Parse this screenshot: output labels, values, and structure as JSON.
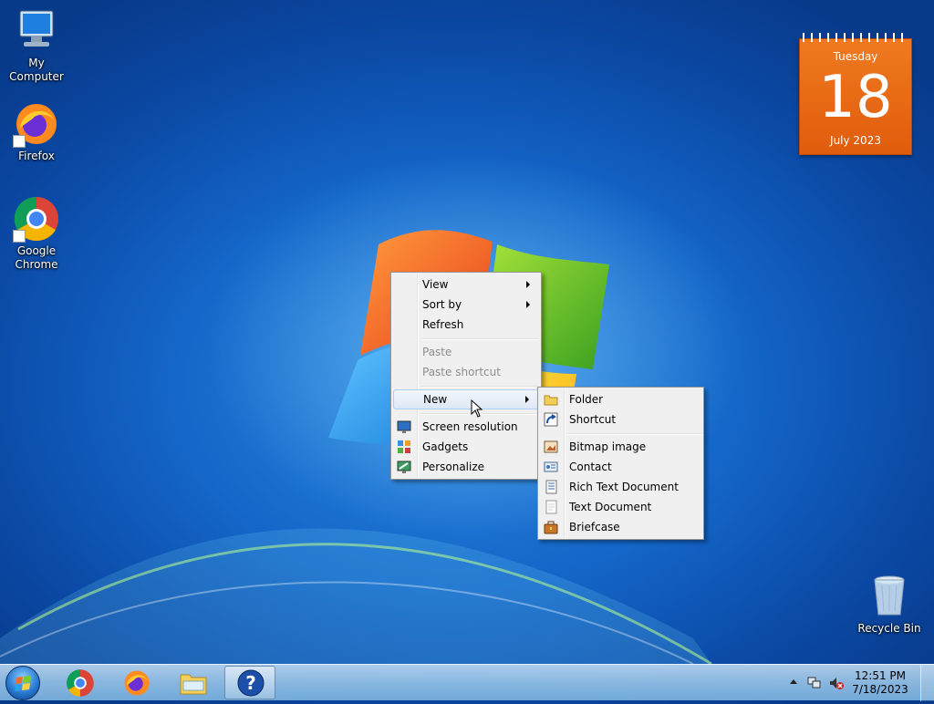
{
  "desktop": {
    "icons": [
      {
        "label": "My Computer",
        "icon": "computer-icon"
      },
      {
        "label": "Firefox",
        "icon": "firefox-icon"
      },
      {
        "label": "Google Chrome",
        "icon": "chrome-icon"
      },
      {
        "label": "Recycle Bin",
        "icon": "recycle-bin-icon"
      }
    ]
  },
  "calendar_gadget": {
    "weekday": "Tuesday",
    "day": "18",
    "month_year": "July 2023"
  },
  "context_menu": {
    "items": [
      {
        "label": "View",
        "has_submenu": true,
        "enabled": true
      },
      {
        "label": "Sort by",
        "has_submenu": true,
        "enabled": true
      },
      {
        "label": "Refresh",
        "has_submenu": false,
        "enabled": true
      },
      {
        "label": "Paste",
        "has_submenu": false,
        "enabled": false
      },
      {
        "label": "Paste shortcut",
        "has_submenu": false,
        "enabled": false
      },
      {
        "label": "New",
        "has_submenu": true,
        "enabled": true,
        "highlighted": true
      },
      {
        "label": "Screen resolution",
        "icon": "screen-resolution-icon",
        "enabled": true
      },
      {
        "label": "Gadgets",
        "icon": "gadgets-icon",
        "enabled": true
      },
      {
        "label": "Personalize",
        "icon": "personalize-icon",
        "enabled": true
      }
    ]
  },
  "new_submenu": {
    "items": [
      {
        "label": "Folder",
        "icon": "folder-icon"
      },
      {
        "label": "Shortcut",
        "icon": "shortcut-icon"
      },
      {
        "label": "Bitmap image",
        "icon": "bitmap-icon"
      },
      {
        "label": "Contact",
        "icon": "contact-icon"
      },
      {
        "label": "Rich Text Document",
        "icon": "rich-text-icon"
      },
      {
        "label": "Text Document",
        "icon": "text-document-icon"
      },
      {
        "label": "Briefcase",
        "icon": "briefcase-icon"
      }
    ]
  },
  "taskbar": {
    "pinned": [
      "chrome-icon",
      "firefox-icon",
      "explorer-icon",
      "help-icon"
    ],
    "clock_time": "12:51 PM",
    "clock_date": "7/18/2023"
  }
}
